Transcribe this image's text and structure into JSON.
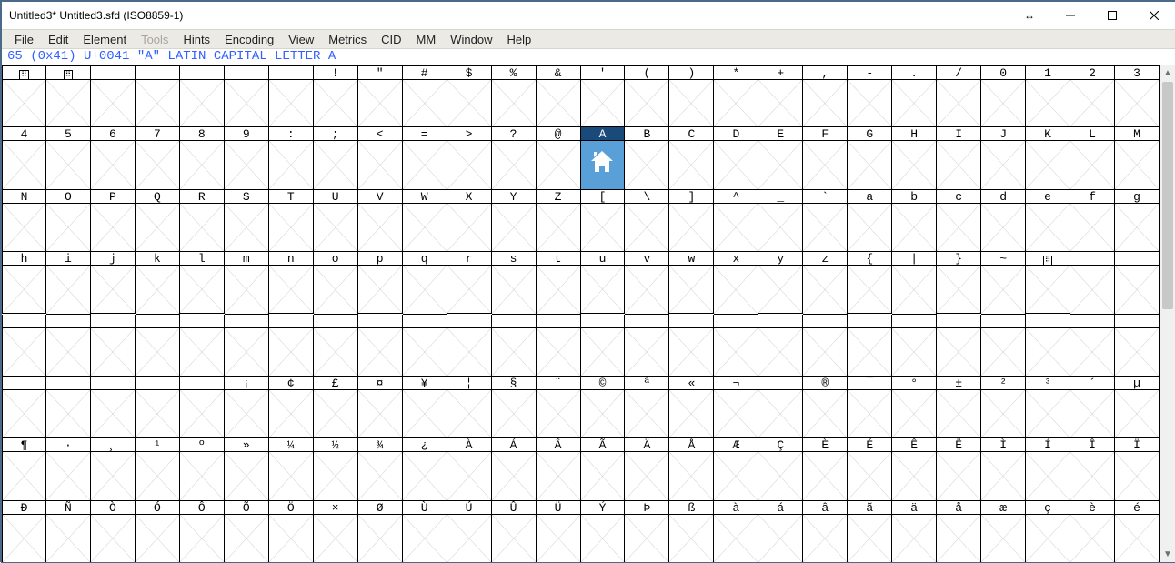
{
  "window": {
    "title": "Untitled3*  Untitled3.sfd (ISO8859-1)"
  },
  "menu": {
    "file": "File",
    "edit": "Edit",
    "element": "Element",
    "tools": "Tools",
    "hints": "Hints",
    "encoding": "Encoding",
    "view": "View",
    "metrics": "Metrics",
    "cid": "CID",
    "mm": "MM",
    "window": "Window",
    "help": "Help"
  },
  "info": "65 (0x41) U+0041 \"A\" LATIN CAPITAL LETTER A",
  "selected_index": 39,
  "rows": [
    [
      "␀",
      "␁",
      "",
      "",
      "",
      "",
      "",
      "!",
      "\"",
      "#",
      "$",
      "%",
      "&",
      "'",
      "(",
      ")",
      "*",
      "+",
      ",",
      "-",
      ".",
      "/",
      "0",
      "1",
      "2",
      "3"
    ],
    [
      "4",
      "5",
      "6",
      "7",
      "8",
      "9",
      ":",
      ";",
      "<",
      "=",
      ">",
      "?",
      "@",
      "A",
      "B",
      "C",
      "D",
      "E",
      "F",
      "G",
      "H",
      "I",
      "J",
      "K",
      "L",
      "M"
    ],
    [
      "N",
      "O",
      "P",
      "Q",
      "R",
      "S",
      "T",
      "U",
      "V",
      "W",
      "X",
      "Y",
      "Z",
      "[",
      "\\",
      "]",
      "^",
      "_",
      "`",
      "a",
      "b",
      "c",
      "d",
      "e",
      "f",
      "g"
    ],
    [
      "h",
      "i",
      "j",
      "k",
      "l",
      "m",
      "n",
      "o",
      "p",
      "q",
      "r",
      "s",
      "t",
      "u",
      "v",
      "w",
      "x",
      "y",
      "z",
      "{",
      "|",
      "}",
      "~",
      "␡",
      "",
      ""
    ],
    [
      "",
      "",
      "",
      "",
      "",
      "",
      "",
      "",
      "",
      "",
      "",
      "",
      "",
      "",
      "",
      "",
      "",
      "",
      "",
      "",
      "",
      "",
      "",
      "",
      "",
      ""
    ],
    [
      "",
      "",
      "",
      "",
      "",
      "¡",
      "¢",
      "£",
      "¤",
      "¥",
      "¦",
      "§",
      "¨",
      "©",
      "ª",
      "«",
      "¬",
      "­",
      "®",
      "¯",
      "°",
      "±",
      "²",
      "³",
      "´",
      "µ"
    ],
    [
      "¶",
      "·",
      "¸",
      "¹",
      "º",
      "»",
      "¼",
      "½",
      "¾",
      "¿",
      "À",
      "Á",
      "Â",
      "Ã",
      "Ä",
      "Å",
      "Æ",
      "Ç",
      "È",
      "É",
      "Ê",
      "Ë",
      "Ì",
      "Í",
      "Î",
      "Ï"
    ],
    [
      "Ð",
      "Ñ",
      "Ò",
      "Ó",
      "Ô",
      "Õ",
      "Ö",
      "×",
      "Ø",
      "Ù",
      "Ú",
      "Û",
      "Ü",
      "Ý",
      "Þ",
      "ß",
      "à",
      "á",
      "â",
      "ã",
      "ä",
      "å",
      "æ",
      "ç",
      "è",
      "é"
    ]
  ],
  "control_chars": [
    "␀",
    "␁",
    "␡"
  ]
}
